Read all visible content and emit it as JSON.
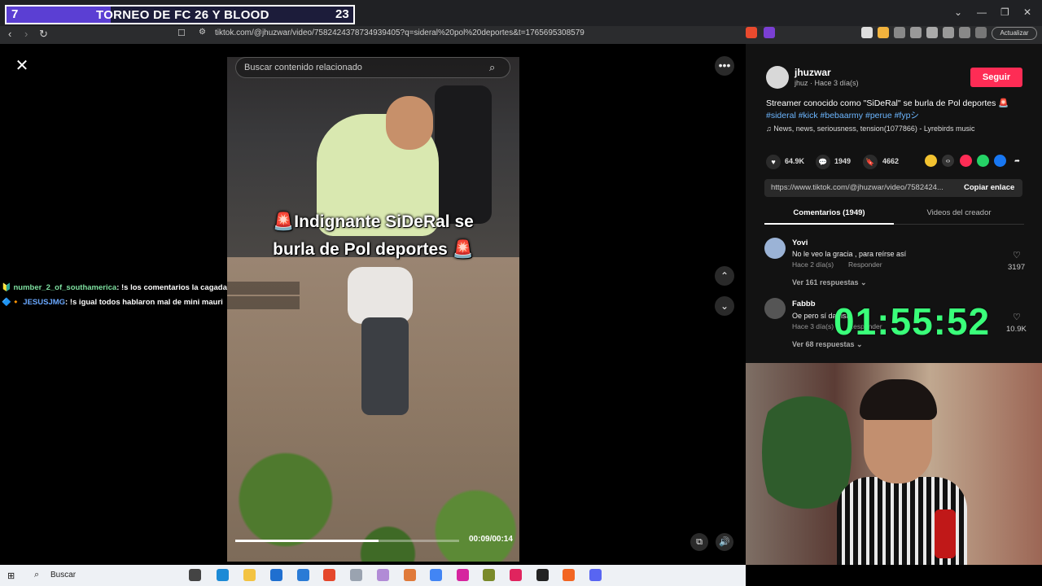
{
  "scoreboard": {
    "left_score": "7",
    "title": "TORNEO DE FC 26 Y BLOOD",
    "right_score": "23"
  },
  "browser": {
    "url": "tiktok.com/@jhuzwar/video/7582424378734939405?q=sideral%20pol%20deportes&t=1765695308579",
    "update_label": "Actualizar"
  },
  "video": {
    "search_placeholder": "Buscar contenido relacionado",
    "caption_line1": "🚨Indignante SiDeRal se",
    "caption_line2": "burla de Pol deportes 🚨",
    "time": "00:09/00:14",
    "progress": 0.64
  },
  "chat": [
    {
      "user": "number_2_of_southamerica",
      "message": ": !s los comentarios la cagada"
    },
    {
      "user": "JESUSJMG",
      "message": ": !s igual todos hablaron mal de mini mauri"
    }
  ],
  "post": {
    "author": "jhuzwar",
    "meta": "jhuz · Hace 3 día(s)",
    "follow_label": "Seguir",
    "description": "Streamer conocido como \"SiDeRal\" se burla de Pol deportes 🚨",
    "hashtags": "#sideral #kick #bebaarmy #perue #fypシ",
    "music": "♫  News, news, seriousness, tension(1077866) - Lyrebirds music",
    "likes": "64.9K",
    "comments": "1949",
    "saves": "4662",
    "link": "https://www.tiktok.com/@jhuzwar/video/7582424...",
    "copy_label": "Copiar enlace",
    "tab_comments": "Comentarios (1949)",
    "tab_creator": "Videos del creador"
  },
  "comments": [
    {
      "name": "Yovi",
      "text": "No le veo la gracia , para reírse así",
      "meta": "Hace 2 día(s)",
      "reply": "Responder",
      "likes": "3197",
      "more": "Ver 161 respuestas ⌄"
    },
    {
      "name": "Fabbb",
      "text": "Oe pero sí da risa",
      "meta": "Hace 3 día(s)",
      "reply": "Responder",
      "likes": "10.9K",
      "more": "Ver 68 respuestas ⌄"
    }
  ],
  "stream_timer": "01:55:52",
  "taskbar": {
    "search_label": "Buscar"
  }
}
